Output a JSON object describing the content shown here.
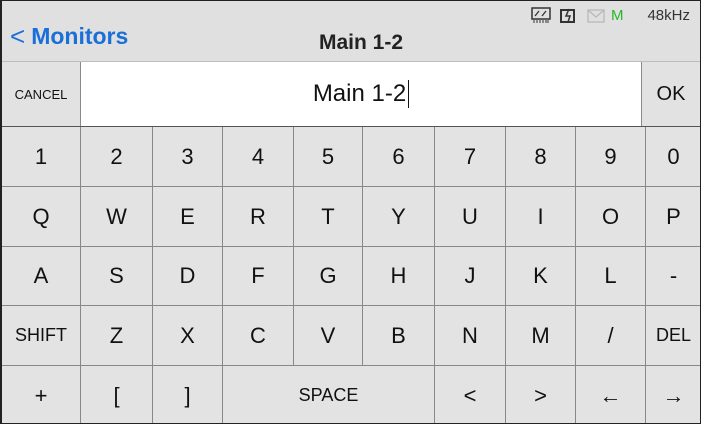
{
  "header": {
    "back_label": "Monitors",
    "title": "Main 1-2",
    "status": {
      "meter_icon": "meter-icon",
      "card_icon": "card-icon",
      "mail_icon": "mail-icon",
      "m_label": "M",
      "sample_rate": "48kHz"
    }
  },
  "entry": {
    "cancel_label": "CANCEL",
    "value": "Main 1-2",
    "ok_label": "OK"
  },
  "keyboard": {
    "rows": [
      [
        "1",
        "2",
        "3",
        "4",
        "5",
        "6",
        "7",
        "8",
        "9",
        "0"
      ],
      [
        "Q",
        "W",
        "E",
        "R",
        "T",
        "Y",
        "U",
        "I",
        "O",
        "P"
      ],
      [
        "A",
        "S",
        "D",
        "F",
        "G",
        "H",
        "J",
        "K",
        "L",
        "-"
      ],
      [
        "SHIFT",
        "Z",
        "X",
        "C",
        "V",
        "B",
        "N",
        "M",
        "/",
        "DEL"
      ],
      [
        "+",
        "[",
        "]",
        "SPACE",
        "<",
        ">",
        "←",
        "→"
      ]
    ]
  },
  "colors": {
    "accent": "#1a6fd8",
    "m_green": "#2db52d",
    "key_bg": "#e3e3e3",
    "header_bg": "#e0e0e0"
  }
}
